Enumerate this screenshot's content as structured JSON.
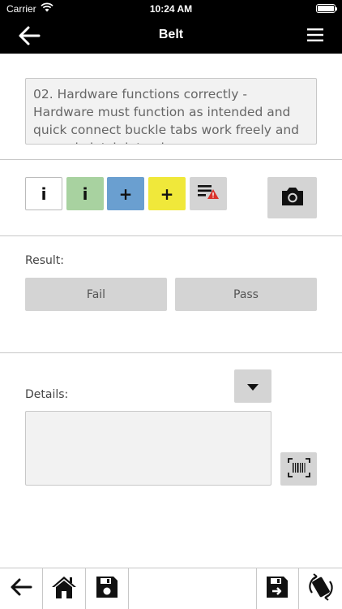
{
  "status_bar": {
    "carrier": "Carrier",
    "time": "10:24 AM",
    "battery_level": 1.0
  },
  "nav": {
    "title": "Belt",
    "back_icon": "arrow-left-icon",
    "menu_icon": "hamburger-menu-icon"
  },
  "inspection": {
    "description": "02. Hardware functions correctly  - Hardware must function as intended and quick connect buckle tabs work freely and securely latch into place."
  },
  "tools": {
    "info_label": "i",
    "info_green_label": "i",
    "add_blue_label": "+",
    "add_yellow_label": "+",
    "colors": {
      "info_green": "#a8d2a0",
      "add_blue": "#6a9fd0",
      "add_yellow": "#f0e83a",
      "neutral": "#d4d4d4",
      "warning_red": "#d9332b"
    }
  },
  "result": {
    "label": "Result:",
    "fail_label": "Fail",
    "pass_label": "Pass"
  },
  "details": {
    "label": "Details:",
    "value": "",
    "placeholder": ""
  },
  "toolbar": {
    "icons": [
      "arrow-left-icon",
      "home-icon",
      "save-icon",
      "save-next-icon",
      "rotate-device-icon"
    ]
  }
}
